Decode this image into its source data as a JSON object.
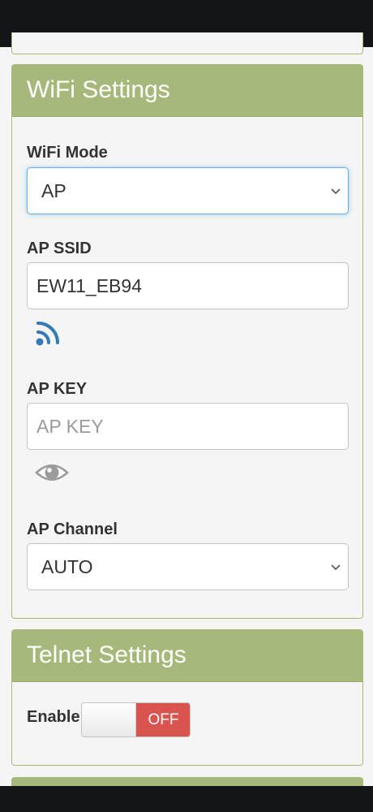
{
  "wifi_settings": {
    "heading": "WiFi Settings",
    "wifi_mode": {
      "label": "WiFi Mode",
      "value": "AP"
    },
    "ap_ssid": {
      "label": "AP SSID",
      "value": "EW11_EB94"
    },
    "ap_key": {
      "label": "AP KEY",
      "value": "",
      "placeholder": "AP KEY"
    },
    "ap_channel": {
      "label": "AP Channel",
      "value": "AUTO"
    }
  },
  "telnet_settings": {
    "heading": "Telnet Settings",
    "enable": {
      "label": "Enable",
      "state": "OFF"
    }
  },
  "colors": {
    "panel_heading": "#a7b97a",
    "off_button": "#d9534f",
    "wifi_icon": "#337ab7",
    "focus_border": "#66afe9"
  },
  "icons": [
    "wifi-scan-icon",
    "eye-icon",
    "chevron-down-icon"
  ]
}
